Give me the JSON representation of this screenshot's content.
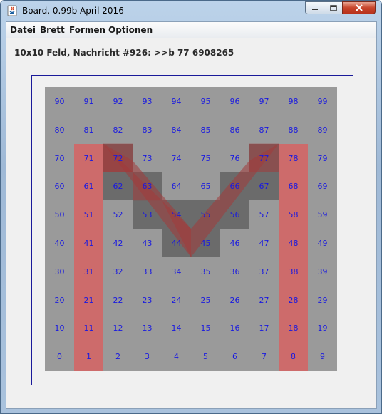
{
  "window": {
    "title": "Board, 0.99b April 2016",
    "icon": "java-app-icon",
    "controls": [
      "minimize-icon",
      "maximize-icon",
      "close-icon"
    ]
  },
  "menubar": {
    "items": [
      "Datei",
      "Brett",
      "Formen",
      "Optionen"
    ]
  },
  "message": "10x10 Feld, Nachricht #926: >>b 77 6908265",
  "board": {
    "size": 10,
    "numbers": [
      [
        "90",
        "91",
        "92",
        "93",
        "94",
        "95",
        "96",
        "97",
        "98",
        "99"
      ],
      [
        "80",
        "81",
        "82",
        "83",
        "84",
        "85",
        "86",
        "87",
        "88",
        "89"
      ],
      [
        "70",
        "71",
        "72",
        "73",
        "74",
        "75",
        "76",
        "77",
        "78",
        "79"
      ],
      [
        "60",
        "61",
        "62",
        "63",
        "64",
        "65",
        "66",
        "67",
        "68",
        "69"
      ],
      [
        "50",
        "51",
        "52",
        "53",
        "54",
        "55",
        "56",
        "57",
        "58",
        "59"
      ],
      [
        "40",
        "41",
        "42",
        "43",
        "44",
        "45",
        "46",
        "47",
        "48",
        "49"
      ],
      [
        "30",
        "31",
        "32",
        "33",
        "34",
        "35",
        "36",
        "37",
        "38",
        "39"
      ],
      [
        "20",
        "21",
        "22",
        "23",
        "24",
        "25",
        "26",
        "27",
        "28",
        "29"
      ],
      [
        "10",
        "11",
        "12",
        "13",
        "14",
        "15",
        "16",
        "17",
        "18",
        "19"
      ],
      [
        "0",
        "1",
        "2",
        "3",
        "4",
        "5",
        "6",
        "7",
        "8",
        "9"
      ]
    ],
    "dark_cells": [
      "72",
      "77",
      "62",
      "63",
      "66",
      "67",
      "53",
      "54",
      "55",
      "56",
      "44",
      "45"
    ],
    "red_columns": [
      1,
      8
    ],
    "colors": {
      "board": "#9a9a9a",
      "dark_cell": "#6b6b6b",
      "red": "#cd6b6b",
      "overlay_red": "#a23a3a",
      "number": "#1a1ae0",
      "frame": "#1a1a9a"
    }
  }
}
